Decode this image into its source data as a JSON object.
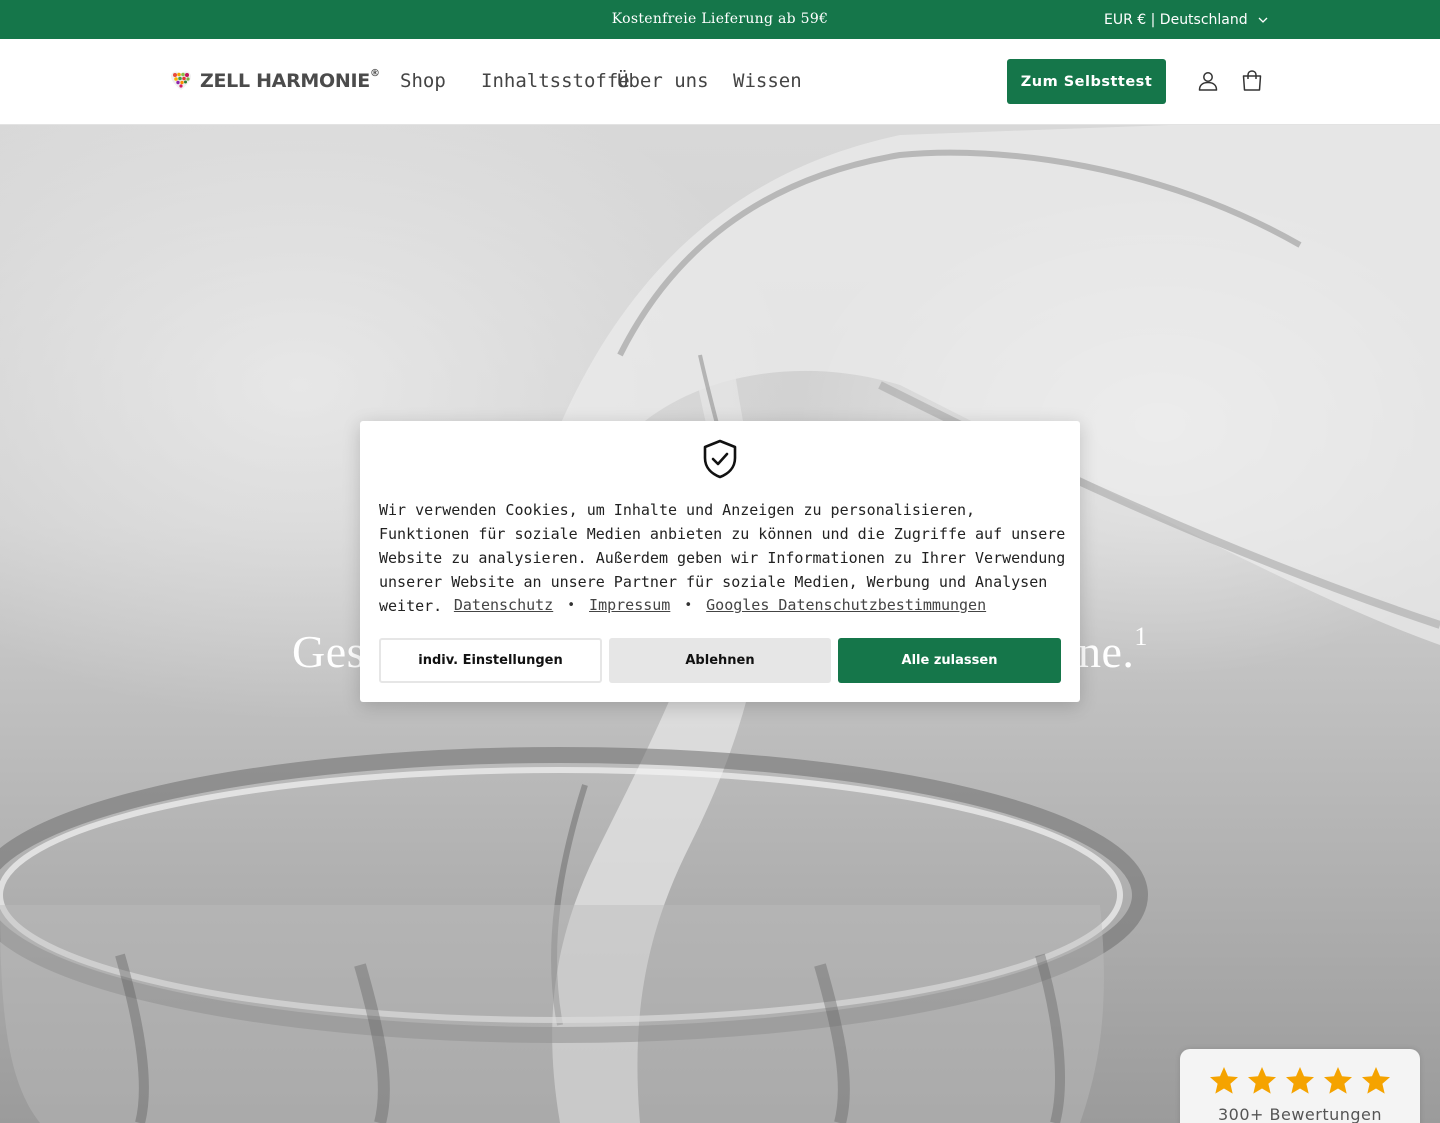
{
  "colors": {
    "brand_green": "#15764a",
    "text": "#222222",
    "star": "#f5a300"
  },
  "announcement": {
    "message": "Kostenfreie Lieferung ab 59€",
    "locale_label": "EUR € | Deutschland",
    "locale_icon": "chevron-down-icon"
  },
  "header": {
    "logo": {
      "icon": "heart-logo-icon",
      "text": "ZELL HARMONIE",
      "registered": "®"
    },
    "nav": [
      {
        "label": "Shop"
      },
      {
        "label": "Inhaltsstoffe"
      },
      {
        "label": "Über uns"
      },
      {
        "label": "Wissen"
      }
    ],
    "cta_label": "Zum Selbsttest",
    "account_icon": "user-icon",
    "cart_icon": "shopping-bag-icon"
  },
  "hero": {
    "headline_left": "Ges",
    "headline_right": "ne.",
    "headline_sup": "1"
  },
  "cookie_banner": {
    "icon": "shield-check-icon",
    "text": "Wir verwenden Cookies, um Inhalte und Anzeigen zu personalisieren, Funktionen für soziale Medien anbieten zu können und die Zugriffe auf unsere Website zu analysieren. Außerdem geben wir Informationen zu Ihrer Verwendung unserer Website an unsere Partner für soziale Medien, Werbung und Analysen weiter.",
    "links": [
      {
        "label": "Datenschutz"
      },
      {
        "label": "Impressum"
      },
      {
        "label": "Googles Datenschutzbestimmungen"
      }
    ],
    "separator": "•",
    "buttons": {
      "settings": "indiv. Einstellungen",
      "reject": "Ablehnen",
      "accept": "Alle zulassen"
    }
  },
  "reviews_widget": {
    "rating_stars": 5,
    "star_icon": "star-icon",
    "count_label": "300+ Bewertungen"
  }
}
